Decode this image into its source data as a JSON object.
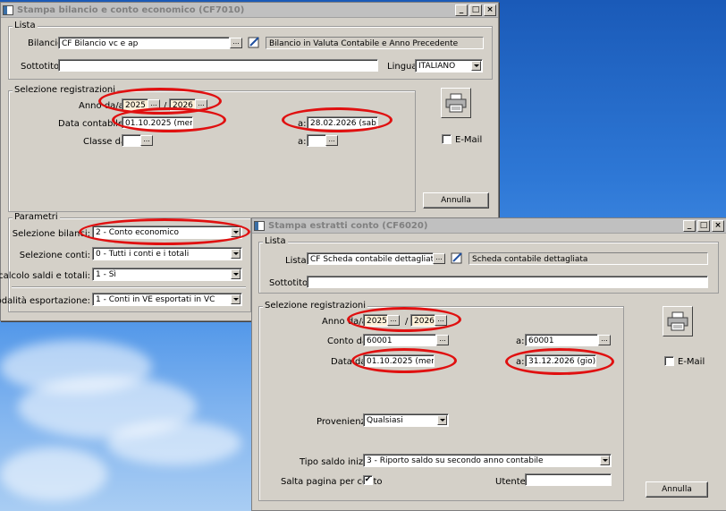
{
  "window1": {
    "title": "Stampa bilancio e conto economico (CF7010)",
    "lista": {
      "legend": "Lista",
      "bilancio_label": "Bilancio:",
      "bilancio_value": "CF Bilancio vc e ap",
      "bilancio_desc": "Bilancio in Valuta Contabile e  Anno Precedente",
      "sottotitolo_label": "Sottotitolo:",
      "sottotitolo_value": "",
      "lingua_label": "Lingua:",
      "lingua_value": "ITALIANO"
    },
    "selezione": {
      "legend": "Selezione registrazioni",
      "anno_label": "Anno da/a:",
      "anno_da": "2025",
      "anno_sep": "/",
      "anno_a": "2026",
      "data_label": "Data contabile da:",
      "data_da": "01.10.2025 (mer)",
      "data_a_label": "a:",
      "data_a": "28.02.2026 (sab)",
      "classe_label": "Classe da:",
      "classe_a_label": "a:"
    },
    "email_label": "E-Mail",
    "annulla_label": "Annulla",
    "parametri": {
      "legend": "Parametri",
      "sel_bilanci_label": "Selezione bilanci:",
      "sel_bilanci_value": "2 - Conto economico",
      "sel_conti_label": "Selezione conti:",
      "sel_conti_value": "0 - Tutti i conti e i totali",
      "ricalcolo_label": "Ricalcolo saldi e totali:",
      "ricalcolo_value": "1 - Sì",
      "modalita_label": "Modalità esportazione:",
      "modalita_value": "1 - Conti in VE esportati in VC"
    }
  },
  "window2": {
    "title": "Stampa estratti conto (CF6020)",
    "lista": {
      "legend": "Lista",
      "lista_label": "Lista:",
      "lista_value": "CF Scheda contabile dettagliata",
      "lista_desc": "Scheda contabile dettagliata",
      "sottotitolo_label": "Sottotitolo:",
      "sottotitolo_value": ""
    },
    "selezione": {
      "legend": "Selezione registrazioni",
      "anno_label": "Anno da/a:",
      "anno_da": "2025",
      "anno_sep": "/",
      "anno_a": "2026",
      "conto_label": "Conto da:",
      "conto_da": "60001",
      "conto_a_label": "a:",
      "conto_a": "60001",
      "data_label": "Data da:",
      "data_da": "01.10.2025 (mer)",
      "data_a_label": "a:",
      "data_a": "31.12.2026 (gio)",
      "provenienza_label": "Provenienza:",
      "provenienza_value": "Qualsiasi",
      "tipo_saldo_label": "Tipo saldo iniziale:",
      "tipo_saldo_value": "3 - Riporto saldo su secondo anno contabile",
      "salta_label": "Salta pagina per conto",
      "salta_checked": "✔",
      "utente_label": "Utente:",
      "utente_value": ""
    },
    "email_label": "E-Mail",
    "annulla_label": "Annulla"
  },
  "colors": {
    "window_bg": "#d4d0c8",
    "highlight_circle": "#e01010",
    "desktop_sky": "#2e78d6"
  }
}
